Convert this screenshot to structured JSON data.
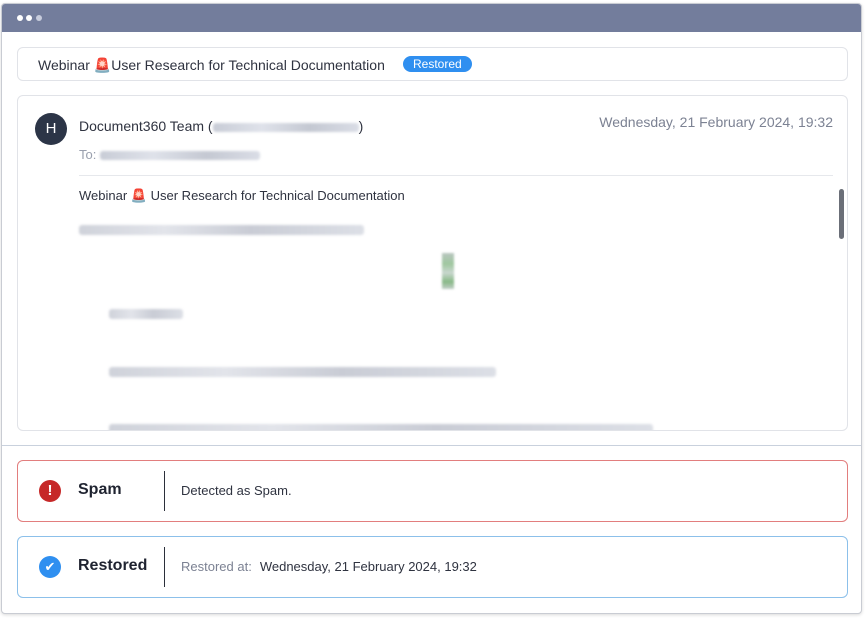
{
  "subject": {
    "prefix": "Webinar",
    "icon": "siren-emoji-icon",
    "text": "User Research for Technical Documentation",
    "status_badge": "Restored"
  },
  "message": {
    "avatar_initial": "H",
    "sender_name": "Document360 Team",
    "to_label": "To:",
    "timestamp": "Wednesday, 21 February 2024, 19:32",
    "body_title_prefix": "Webinar",
    "body_title_text": "User Research for Technical Documentation"
  },
  "statuses": {
    "spam": {
      "name": "Spam",
      "detail": "Detected as Spam.",
      "icon": "exclamation-icon",
      "color": "#c62828"
    },
    "restored": {
      "name": "Restored",
      "detail_label": "Restored at:",
      "detail_value": "Wednesday, 21 February 2024, 19:32",
      "icon": "checkmark-icon",
      "color": "#2f8ff0"
    }
  },
  "colors": {
    "titlebar": "#737d9c",
    "badge": "#2f8ff0",
    "spam_border": "#e27e7e",
    "restored_border": "#8cc0ea"
  }
}
